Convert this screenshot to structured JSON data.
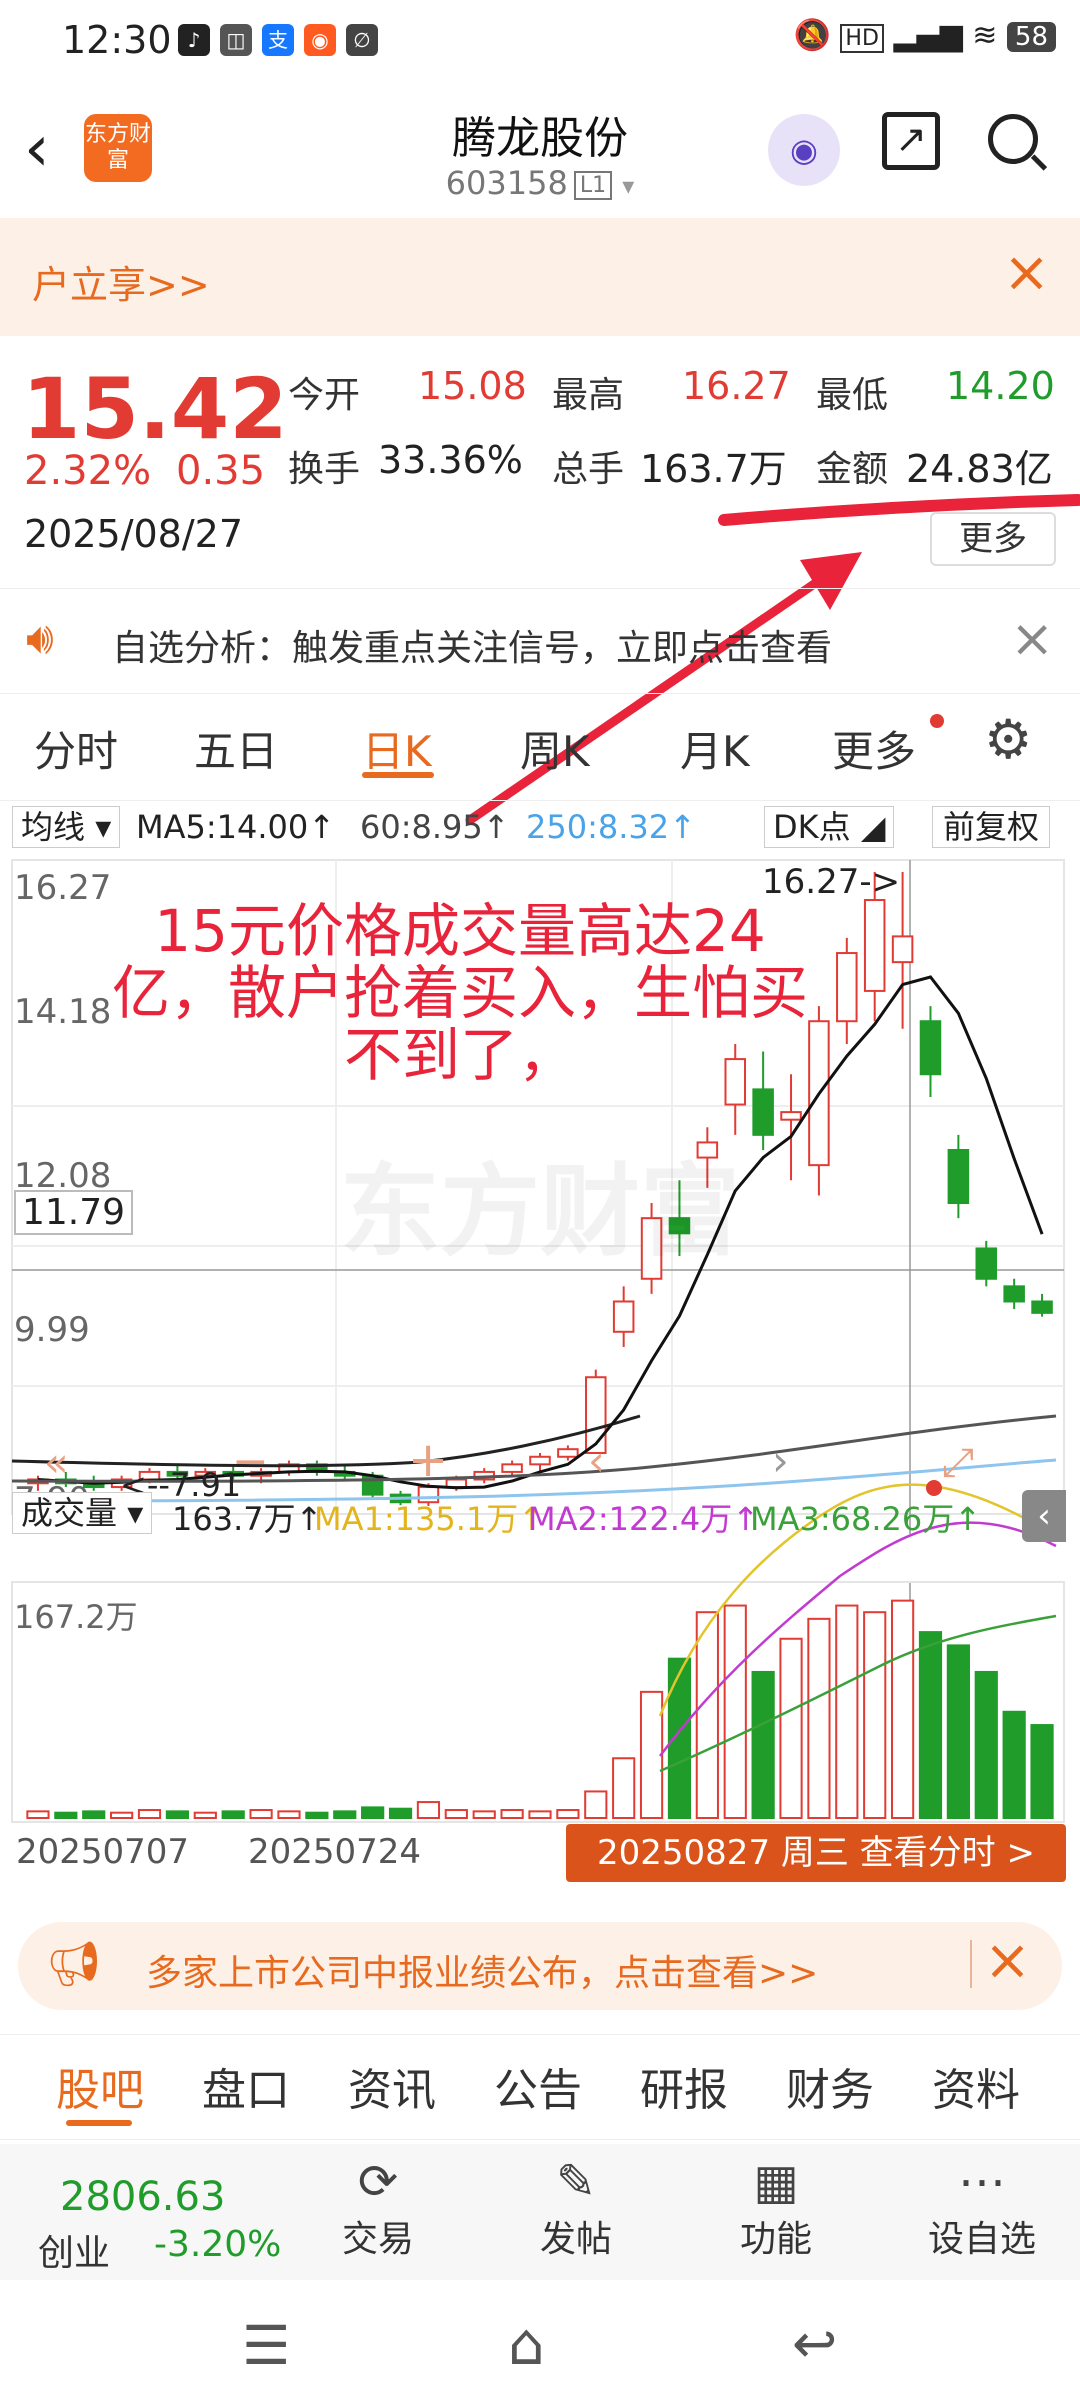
{
  "status_bar": {
    "time": "12:30",
    "battery": "58"
  },
  "header": {
    "stock_name": "腾龙股份",
    "stock_code": "603158",
    "level": "L1",
    "logo_text": "东方财富"
  },
  "banner": {
    "text": "户立享>>"
  },
  "quote": {
    "price": "15.42",
    "change_pct": "2.32%",
    "change_amt": "0.35",
    "date": "2025/08/27",
    "open_label": "今开",
    "open": "15.08",
    "high_label": "最高",
    "high": "16.27",
    "low_label": "最低",
    "low": "14.20",
    "turnover_label": "换手",
    "turnover": "33.36%",
    "volume_label": "总手",
    "volume": "163.7万",
    "amount_label": "金额",
    "amount": "24.83亿",
    "more_button": "更多"
  },
  "analysis_bar": {
    "text": "自选分析：触发重点关注信号，立即点击查看"
  },
  "tabs": [
    "分时",
    "五日",
    "日K",
    "周K",
    "月K",
    "更多"
  ],
  "active_tab_index": 2,
  "chart_legend": {
    "ma_selector": "均线",
    "ma5": "MA5:14.00↑",
    "ma60": "60:8.95↑",
    "ma250": "250:8.32↑",
    "dk_button": "DK点",
    "fq_button": "前复权"
  },
  "annotation": {
    "text": "15元价格成交量高达24亿，散户抢着买入，生怕买不到了，"
  },
  "watermark": "东方财富",
  "price_axis": {
    "top": "16.27",
    "mid1": "14.18",
    "mid2": "12.08",
    "mid3": "9.99",
    "bottom": "7.90",
    "crosshair": "11.79",
    "max_marker": "16.27->",
    "min_marker": "7.91"
  },
  "volume_legend": {
    "selector": "成交量",
    "value": "163.7万↑",
    "ma1": "MA1:135.1万↑",
    "ma2": "MA2:122.4万↑",
    "ma3": "MA3:68.26万↑"
  },
  "volume_axis": {
    "top": "167.2万"
  },
  "date_axis": {
    "d1": "20250707",
    "d2": "20250724",
    "selected": "20250827 周三 查看分时 >"
  },
  "notice": {
    "text": "多家上市公司中报业绩公布，点击查看>>"
  },
  "sub_tabs": [
    "股吧",
    "盘口",
    "资讯",
    "公告",
    "研报",
    "财务",
    "资料"
  ],
  "bottom_bar": {
    "index_value": "2806.63",
    "index_name": "创业",
    "index_change": "-3.20%",
    "trade": "交易",
    "post": "发帖",
    "function": "功能",
    "add_watch": "设自选"
  },
  "colors": {
    "up": "#e23b33",
    "down": "#1f9c2a",
    "accent": "#f26b21"
  },
  "chart_data": {
    "type": "candlestick",
    "title": "",
    "y_range": [
      7.9,
      16.27
    ],
    "candles": [
      {
        "o": 8.2,
        "h": 8.3,
        "l": 8.1,
        "c": 8.25
      },
      {
        "o": 8.25,
        "h": 8.35,
        "l": 8.15,
        "c": 8.2
      },
      {
        "o": 8.2,
        "h": 8.3,
        "l": 8.1,
        "c": 8.15
      },
      {
        "o": 8.15,
        "h": 8.3,
        "l": 8.1,
        "c": 8.25
      },
      {
        "o": 8.25,
        "h": 8.4,
        "l": 8.2,
        "c": 8.35
      },
      {
        "o": 8.35,
        "h": 8.45,
        "l": 8.25,
        "c": 8.3
      },
      {
        "o": 8.3,
        "h": 8.4,
        "l": 8.2,
        "c": 8.35
      },
      {
        "o": 8.35,
        "h": 8.45,
        "l": 8.25,
        "c": 8.3
      },
      {
        "o": 8.3,
        "h": 8.4,
        "l": 8.2,
        "c": 8.35
      },
      {
        "o": 8.35,
        "h": 8.5,
        "l": 8.3,
        "c": 8.45
      },
      {
        "o": 8.45,
        "h": 8.5,
        "l": 8.3,
        "c": 8.35
      },
      {
        "o": 8.35,
        "h": 8.45,
        "l": 8.25,
        "c": 8.3
      },
      {
        "o": 8.3,
        "h": 8.35,
        "l": 8.0,
        "c": 8.05
      },
      {
        "o": 8.05,
        "h": 8.1,
        "l": 7.91,
        "c": 7.95
      },
      {
        "o": 7.95,
        "h": 8.2,
        "l": 7.9,
        "c": 8.15
      },
      {
        "o": 8.15,
        "h": 8.3,
        "l": 8.1,
        "c": 8.25
      },
      {
        "o": 8.25,
        "h": 8.4,
        "l": 8.2,
        "c": 8.35
      },
      {
        "o": 8.35,
        "h": 8.5,
        "l": 8.3,
        "c": 8.45
      },
      {
        "o": 8.45,
        "h": 8.6,
        "l": 8.35,
        "c": 8.55
      },
      {
        "o": 8.55,
        "h": 8.7,
        "l": 8.5,
        "c": 8.65
      },
      {
        "o": 8.6,
        "h": 9.7,
        "l": 8.6,
        "c": 9.6
      },
      {
        "o": 10.2,
        "h": 10.8,
        "l": 10.0,
        "c": 10.6
      },
      {
        "o": 10.9,
        "h": 11.9,
        "l": 10.7,
        "c": 11.7
      },
      {
        "o": 11.7,
        "h": 12.2,
        "l": 11.2,
        "c": 11.5
      },
      {
        "o": 12.5,
        "h": 12.9,
        "l": 12.1,
        "c": 12.7
      },
      {
        "o": 13.2,
        "h": 14.0,
        "l": 12.8,
        "c": 13.8
      },
      {
        "o": 13.4,
        "h": 13.9,
        "l": 12.6,
        "c": 12.8
      },
      {
        "o": 13.0,
        "h": 13.6,
        "l": 12.2,
        "c": 13.1
      },
      {
        "o": 12.4,
        "h": 14.5,
        "l": 12.0,
        "c": 14.3
      },
      {
        "o": 14.3,
        "h": 15.4,
        "l": 14.0,
        "c": 15.2
      },
      {
        "o": 14.7,
        "h": 16.27,
        "l": 14.3,
        "c": 15.9
      },
      {
        "o": 15.08,
        "h": 16.27,
        "l": 14.2,
        "c": 15.42
      },
      {
        "o": 14.3,
        "h": 14.5,
        "l": 13.3,
        "c": 13.6
      },
      {
        "o": 12.6,
        "h": 12.8,
        "l": 11.7,
        "c": 11.9
      },
      {
        "o": 11.3,
        "h": 11.4,
        "l": 10.8,
        "c": 10.9
      },
      {
        "o": 10.8,
        "h": 10.9,
        "l": 10.5,
        "c": 10.6
      },
      {
        "o": 10.6,
        "h": 10.7,
        "l": 10.4,
        "c": 10.45
      }
    ],
    "volume_range": [
      0,
      167.2
    ],
    "volumes": [
      5,
      4,
      5,
      4,
      6,
      5,
      4,
      5,
      6,
      5,
      4,
      5,
      8,
      7,
      12,
      6,
      5,
      6,
      5,
      6,
      20,
      45,
      95,
      120,
      155,
      160,
      110,
      135,
      150,
      160,
      155,
      163.7,
      140,
      130,
      110,
      80,
      70
    ]
  }
}
